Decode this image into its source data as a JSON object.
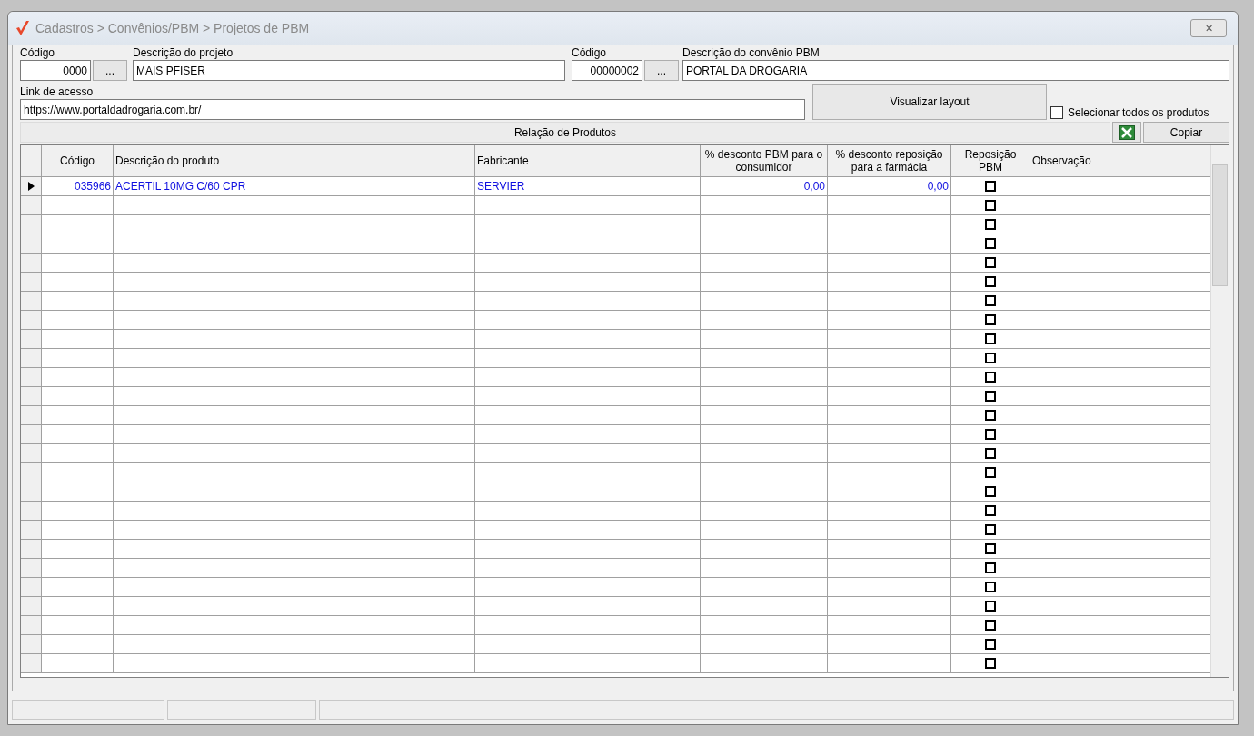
{
  "window": {
    "title": "Cadastros > Convênios/PBM > Projetos de PBM",
    "close": "✕"
  },
  "projeto": {
    "codigo_label": "Código",
    "codigo": "0000",
    "lookup": "...",
    "descricao_label": "Descrição do projeto",
    "descricao": "MAIS PFISER"
  },
  "convenio": {
    "codigo_label": "Código",
    "codigo": "00000002",
    "lookup": "...",
    "descricao_label": "Descrição do convênio PBM",
    "descricao": "PORTAL DA DROGARIA"
  },
  "link": {
    "label": "Link de acesso",
    "value": "https://www.portaldadrogaria.com.br/"
  },
  "visualizar_button": "Visualizar layout",
  "select_all": {
    "label": "Selecionar todos os produtos",
    "checked": false
  },
  "grid_title": "Relação de Produtos",
  "copy_button": "Copiar",
  "columns": [
    "Código",
    "Descrição do produto",
    "Fabricante",
    "% desconto PBM para o consumidor",
    "% desconto reposição para a farmácia",
    "Reposição PBM",
    "Observação"
  ],
  "rows": [
    {
      "selected": true,
      "codigo": "035966",
      "descricao": "ACERTIL 10MG C/60 CPR",
      "fabricante": "SERVIER",
      "desconto_consumidor": "0,00",
      "desconto_reposicao": "0,00",
      "reposicao_pbm": false
    },
    {
      "selected": false,
      "reposicao_pbm": false
    },
    {
      "selected": false,
      "reposicao_pbm": false
    },
    {
      "selected": false,
      "reposicao_pbm": false
    },
    {
      "selected": false,
      "reposicao_pbm": false
    },
    {
      "selected": false,
      "reposicao_pbm": false
    },
    {
      "selected": false,
      "reposicao_pbm": false
    },
    {
      "selected": false,
      "reposicao_pbm": false
    },
    {
      "selected": false,
      "reposicao_pbm": false
    },
    {
      "selected": false,
      "reposicao_pbm": false
    },
    {
      "selected": false,
      "reposicao_pbm": false
    },
    {
      "selected": false,
      "reposicao_pbm": false
    },
    {
      "selected": false,
      "reposicao_pbm": false
    },
    {
      "selected": false,
      "reposicao_pbm": false
    },
    {
      "selected": false,
      "reposicao_pbm": false
    },
    {
      "selected": false,
      "reposicao_pbm": false
    },
    {
      "selected": false,
      "reposicao_pbm": false
    },
    {
      "selected": false,
      "reposicao_pbm": false
    },
    {
      "selected": false,
      "reposicao_pbm": false
    },
    {
      "selected": false,
      "reposicao_pbm": false
    },
    {
      "selected": false,
      "reposicao_pbm": false
    },
    {
      "selected": false,
      "reposicao_pbm": false
    },
    {
      "selected": false,
      "reposicao_pbm": false
    },
    {
      "selected": false,
      "reposicao_pbm": false
    },
    {
      "selected": false,
      "reposicao_pbm": false
    },
    {
      "selected": false,
      "reposicao_pbm": false
    }
  ]
}
